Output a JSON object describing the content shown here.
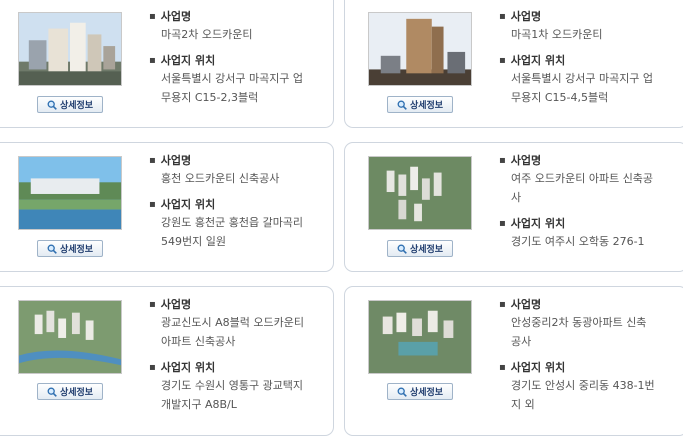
{
  "labels": {
    "project_name": "사업명",
    "project_location": "사업지 위치",
    "detail_button": "상세정보"
  },
  "projects": [
    {
      "name": "마곡2차 오드카운티",
      "location": "서울특별시 강서구 마곡지구 업\n무용지 C15-2,3블럭"
    },
    {
      "name": "마곡1차 오드카운티",
      "location": "서울특별시 강서구 마곡지구 업\n무용지 C15-4,5블럭"
    },
    {
      "name": "홍천 오드카운티 신축공사",
      "location": "강원도 홍천군 홍천읍 갈마곡리\n549번지 일원"
    },
    {
      "name": "여주 오드카운티 아파트 신축공\n사",
      "location": "경기도 여주시 오학동 276-1"
    },
    {
      "name": "광교신도시 A8블럭 오드카운티\n아파트 신축공사",
      "location": "경기도 수원시 영통구 광교택지\n개발지구 A8B/L"
    },
    {
      "name": "안성중리2차 동광아파트 신축\n공사",
      "location": "경기도 안성시 중리동 438-1번\n지 외"
    }
  ]
}
